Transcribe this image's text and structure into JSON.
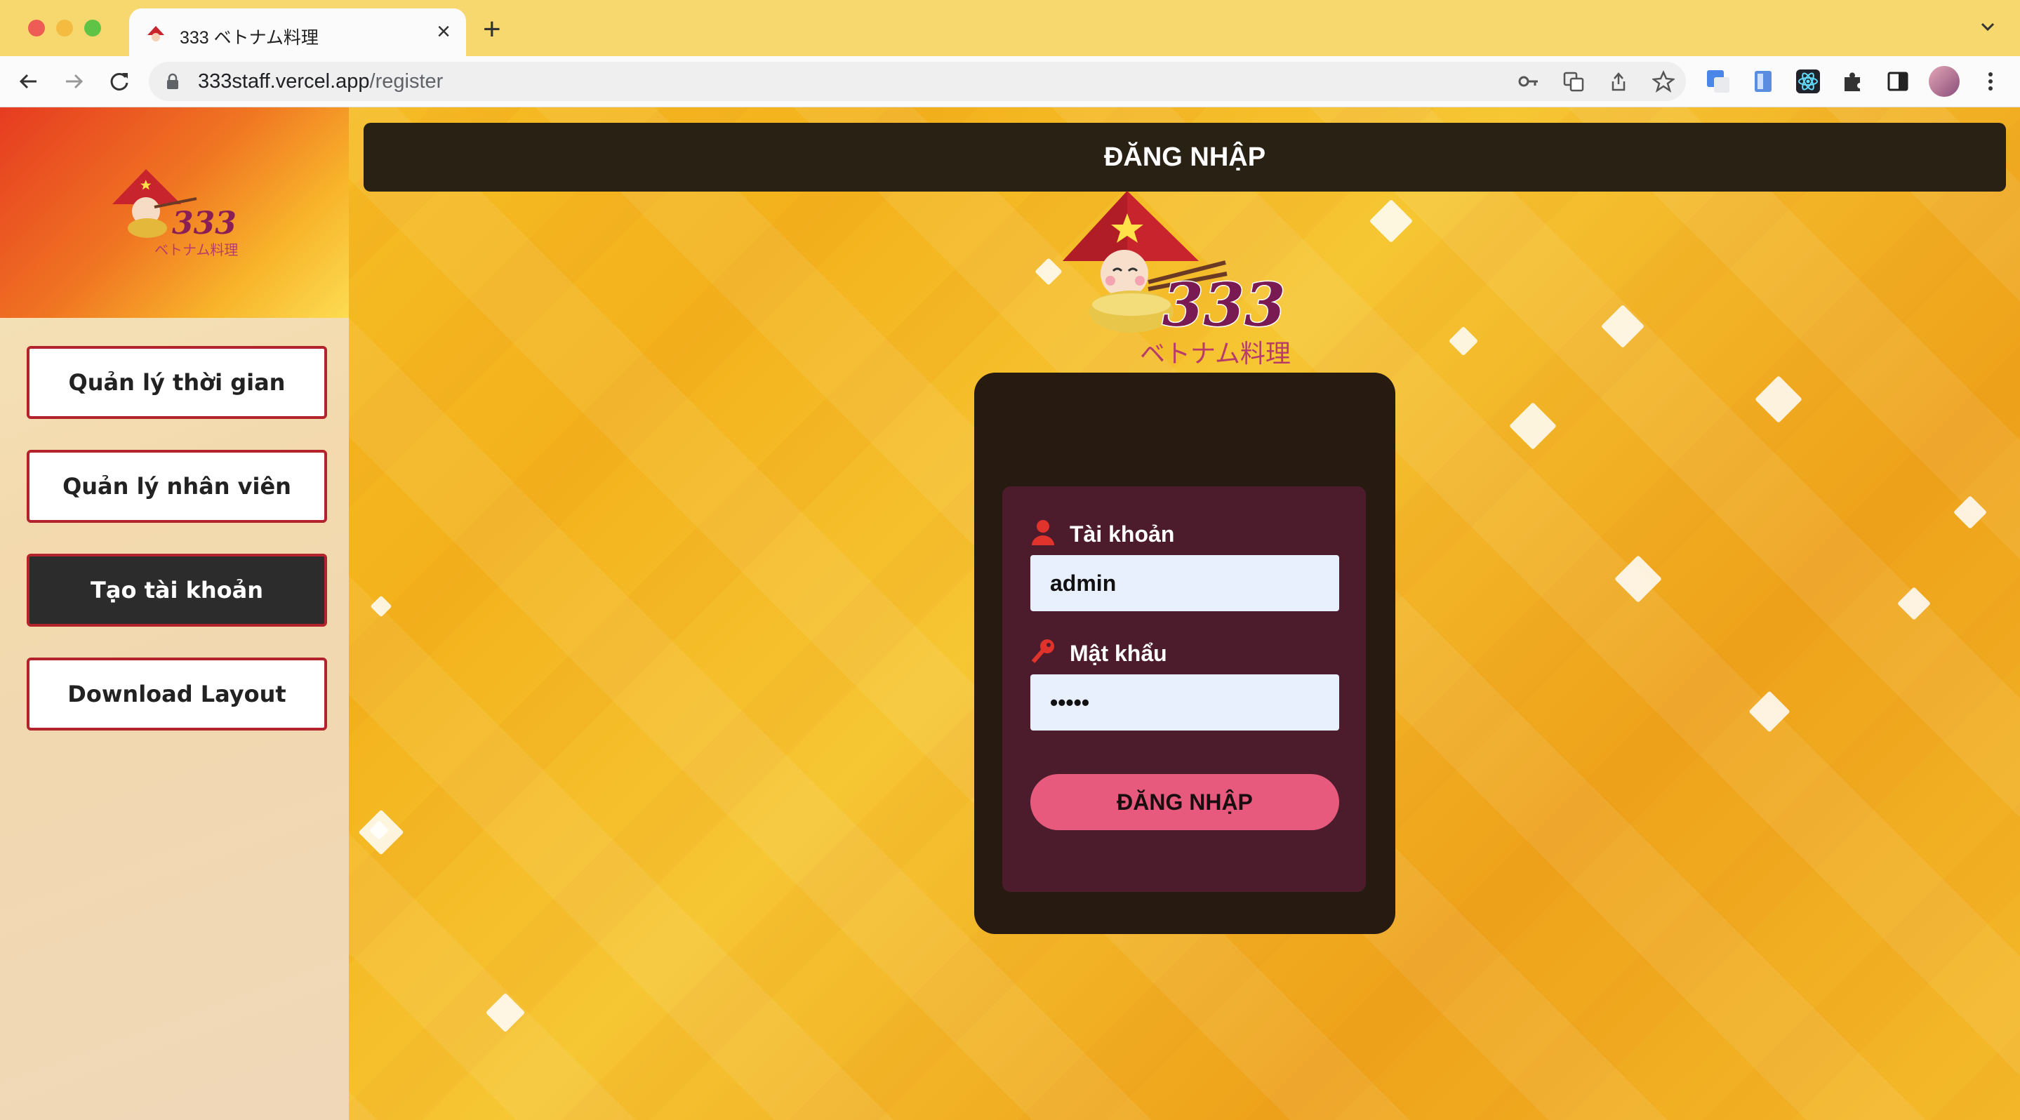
{
  "browser": {
    "tab_title": "333 ベトナム料理",
    "url_host": "333staff.vercel.app",
    "url_path": "/register"
  },
  "sidebar": {
    "items": [
      {
        "label": "Quản lý thời gian",
        "active": false
      },
      {
        "label": "Quản lý nhân viên",
        "active": false
      },
      {
        "label": "Tạo tài khoản",
        "active": true
      },
      {
        "label": "Download Layout",
        "active": false
      }
    ]
  },
  "header": {
    "title": "ĐĂNG NHẬP"
  },
  "login": {
    "username_label": "Tài khoản",
    "username_value": "admin",
    "password_label": "Mật khẩu",
    "password_value": "•••••",
    "submit_label": "ĐĂNG NHẬP"
  },
  "logo": {
    "number": "333",
    "subtitle": "ベトナム料理"
  },
  "colors": {
    "accent": "#e85a7d",
    "dark": "#271a11",
    "panel": "#4c1b2c",
    "sidebar_border": "#b3232c"
  }
}
